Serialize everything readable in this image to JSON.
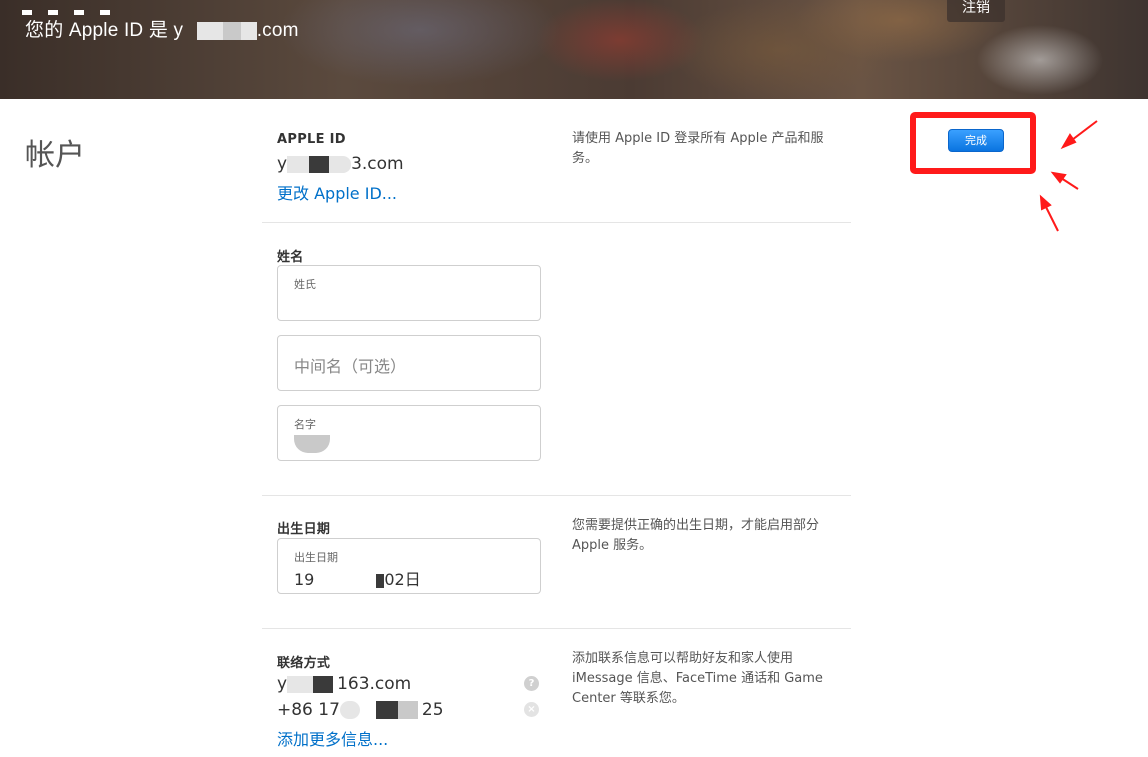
{
  "banner": {
    "apple_id_prefix": "您的 Apple ID 是 y",
    "apple_id_suffix": ".com",
    "logout_label": "注销"
  },
  "section": {
    "title": "帐户"
  },
  "apple_id_block": {
    "label": "APPLE ID",
    "value_prefix": "y",
    "value_suffix": "3.com",
    "change_link": "更改 Apple ID...",
    "description": "请使用 Apple ID 登录所有 Apple 产品和服务。"
  },
  "name_block": {
    "label": "姓名",
    "last_name": {
      "label": "姓氏",
      "value": ""
    },
    "middle_name": {
      "placeholder": "中间名（可选）"
    },
    "first_name": {
      "label": "名字",
      "value": ""
    }
  },
  "birthday_block": {
    "label": "出生日期",
    "field_label": "出生日期",
    "value_prefix": "19",
    "value_suffix": "02日",
    "description": "您需要提供正确的出生日期，才能启用部分 Apple 服务。"
  },
  "contact_block": {
    "label": "联络方式",
    "email_prefix": "y",
    "email_suffix": "163.com",
    "phone_prefix": "+86 17",
    "phone_suffix": "25",
    "add_more_link": "添加更多信息...",
    "description": "添加联系信息可以帮助好友和家人使用 iMessage 信息、FaceTime 通话和 Game Center 等联系您。",
    "help_icon": "question-icon",
    "remove_icon": "close-icon"
  },
  "actions": {
    "done_label": "完成"
  },
  "annotation": {
    "highlight_color": "#ff1a1a",
    "arrow_color": "#ff1a1a"
  },
  "colors": {
    "link": "#0070c9",
    "button": "#0a74e0"
  }
}
